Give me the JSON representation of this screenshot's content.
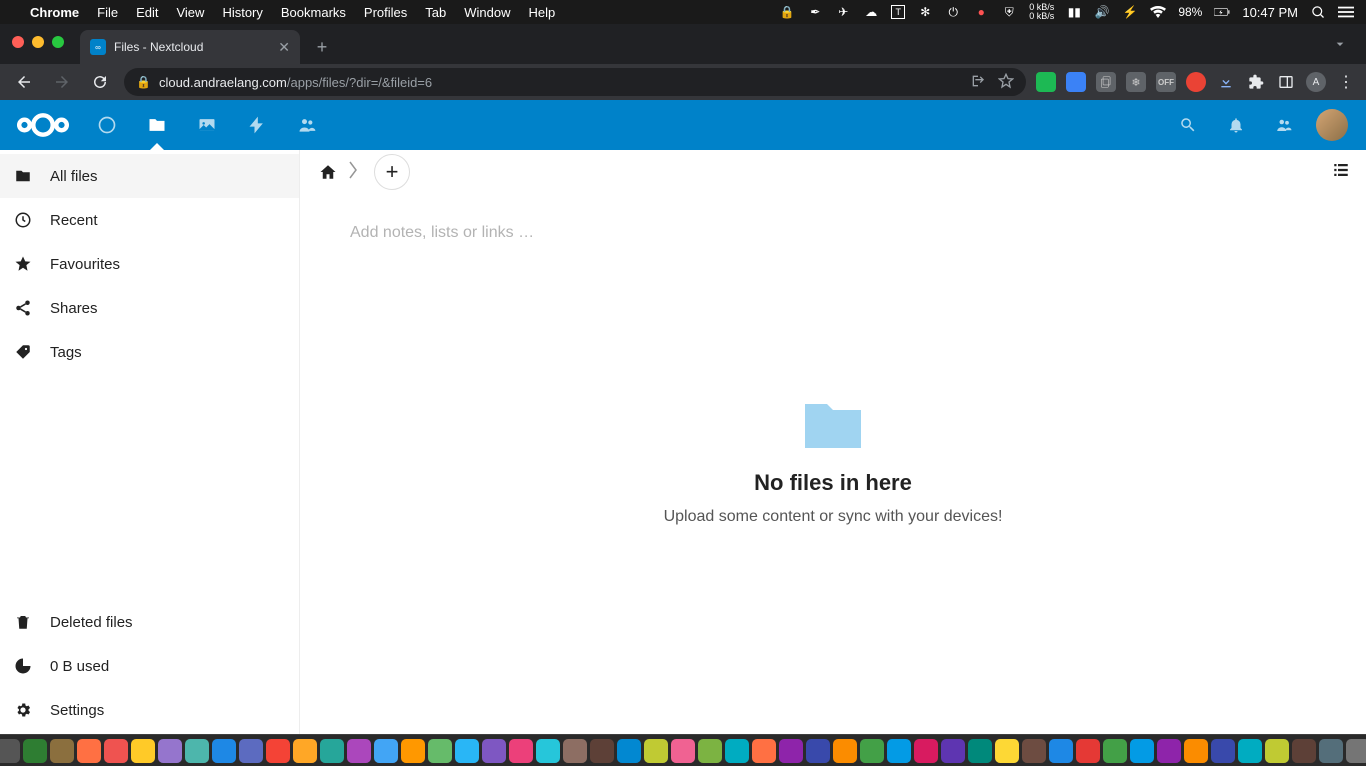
{
  "macos": {
    "app_name": "Chrome",
    "menus": [
      "File",
      "Edit",
      "View",
      "History",
      "Bookmarks",
      "Profiles",
      "Tab",
      "Window",
      "Help"
    ],
    "net_up": "0 kB/s",
    "net_down": "0 kB/s",
    "battery_pct": "98%",
    "clock": "10:47 PM"
  },
  "browser": {
    "tab_title": "Files - Nextcloud",
    "url_host": "cloud.andraelang.com",
    "url_path": "/apps/files/?dir=/&fileid=6",
    "avatar_letter": "A",
    "off_label": "OFF"
  },
  "nextcloud": {
    "sidebar": {
      "items": [
        {
          "label": "All files"
        },
        {
          "label": "Recent"
        },
        {
          "label": "Favourites"
        },
        {
          "label": "Shares"
        },
        {
          "label": "Tags"
        }
      ],
      "deleted": "Deleted files",
      "quota": "0 B used",
      "settings": "Settings"
    },
    "notes_placeholder": "Add notes, lists or links …",
    "empty": {
      "title": "No files in here",
      "subtitle": "Upload some content or sync with your devices!"
    }
  },
  "dock_colors": [
    "#4a90e2",
    "#555",
    "#2e7d32",
    "#8b6f3e",
    "#ff7043",
    "#ef5350",
    "#ffca28",
    "#9575cd",
    "#4db6ac",
    "#1e88e5",
    "#5c6bc0",
    "#f44336",
    "#ffa726",
    "#26a69a",
    "#ab47bc",
    "#42a5f5",
    "#ff9800",
    "#66bb6a",
    "#29b6f6",
    "#7e57c2",
    "#ec407a",
    "#26c6da",
    "#8d6e63",
    "#5d4037",
    "#0288d1",
    "#c0ca33",
    "#f06292",
    "#7cb342",
    "#00acc1",
    "#ff7043",
    "#8e24aa",
    "#3949ab",
    "#fb8c00",
    "#43a047",
    "#039be5",
    "#d81b60",
    "#5e35b1",
    "#00897b",
    "#fdd835",
    "#6d4c41",
    "#1e88e5",
    "#e53935",
    "#43a047",
    "#039be5",
    "#8e24aa",
    "#fb8c00",
    "#3949ab",
    "#00acc1",
    "#c0ca33",
    "#5d4037",
    "#546e7a",
    "#757575",
    "#9e9e9e"
  ]
}
